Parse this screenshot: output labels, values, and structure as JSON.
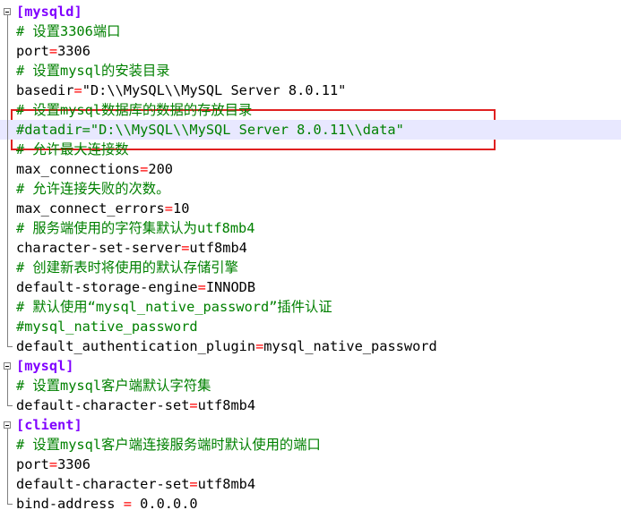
{
  "lines": [
    {
      "type": "section",
      "text": "[mysqld]"
    },
    {
      "type": "comment",
      "text": "# 设置3306端口"
    },
    {
      "type": "kv",
      "key": "port",
      "op": "=",
      "value": "3306"
    },
    {
      "type": "comment",
      "text": "# 设置mysql的安装目录"
    },
    {
      "type": "kv",
      "key": "basedir",
      "op": "=",
      "value": "\"D:\\\\MySQL\\\\MySQL Server 8.0.11\""
    },
    {
      "type": "comment",
      "text": "# 设置mysql数据库的数据的存放目录"
    },
    {
      "type": "comment",
      "text": "#datadir=\"D:\\\\MySQL\\\\MySQL Server 8.0.11\\\\data\""
    },
    {
      "type": "comment",
      "text": "# 允许最大连接数"
    },
    {
      "type": "kv",
      "key": "max_connections",
      "op": "=",
      "value": "200"
    },
    {
      "type": "comment",
      "text": "# 允许连接失败的次数。"
    },
    {
      "type": "kv",
      "key": "max_connect_errors",
      "op": "=",
      "value": "10"
    },
    {
      "type": "comment",
      "text": "# 服务端使用的字符集默认为utf8mb4"
    },
    {
      "type": "kv",
      "key": "character-set-server",
      "op": "=",
      "value": "utf8mb4"
    },
    {
      "type": "comment",
      "text": "# 创建新表时将使用的默认存储引擎"
    },
    {
      "type": "kv",
      "key": "default-storage-engine",
      "op": "=",
      "value": "INNODB"
    },
    {
      "type": "comment",
      "text": "# 默认使用“mysql_native_password”插件认证"
    },
    {
      "type": "comment",
      "text": "#mysql_native_password"
    },
    {
      "type": "kv",
      "key": "default_authentication_plugin",
      "op": "=",
      "value": "mysql_native_password"
    },
    {
      "type": "section",
      "text": "[mysql]"
    },
    {
      "type": "comment",
      "text": "# 设置mysql客户端默认字符集"
    },
    {
      "type": "kv",
      "key": "default-character-set",
      "op": "=",
      "value": "utf8mb4"
    },
    {
      "type": "section",
      "text": "[client]"
    },
    {
      "type": "comment",
      "text": "# 设置mysql客户端连接服务端时默认使用的端口"
    },
    {
      "type": "kv",
      "key": "port",
      "op": "=",
      "value": "3306"
    },
    {
      "type": "kv",
      "key": "default-character-set",
      "op": "=",
      "value": "utf8mb4"
    },
    {
      "type": "kv",
      "key": "bind-address ",
      "op": "=",
      "value": " 0.0.0.0"
    }
  ],
  "colors": {
    "comment": "#008000",
    "section": "#8000ff",
    "operator": "#ff0000",
    "highlight_box": "#e02020"
  }
}
